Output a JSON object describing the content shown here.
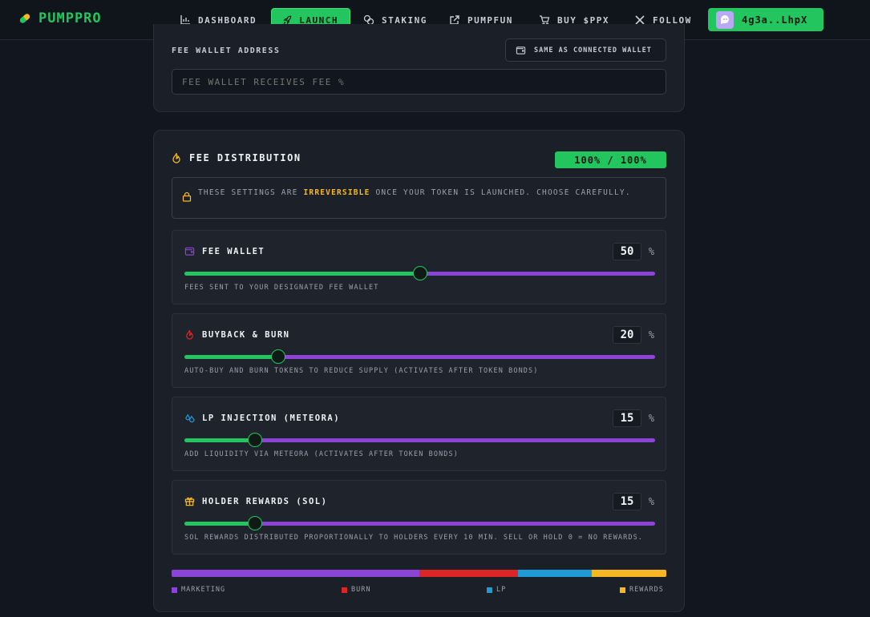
{
  "brand": {
    "name": "PUMPPRO"
  },
  "nav": {
    "items": [
      {
        "label": "DASHBOARD",
        "icon": "bar-chart-icon",
        "active": false
      },
      {
        "label": "LAUNCH",
        "icon": "rocket-icon",
        "active": true
      },
      {
        "label": "STAKING",
        "icon": "coins-icon",
        "active": false
      },
      {
        "label": "PUMPFUN",
        "icon": "external-link-icon",
        "active": false
      },
      {
        "label": "BUY $PPX",
        "icon": "cart-icon",
        "active": false
      },
      {
        "label": "FOLLOW",
        "icon": "x-logo-icon",
        "active": false
      }
    ],
    "wallet": "4g3a..LhpX"
  },
  "fee_wallet": {
    "label": "FEE WALLET ADDRESS",
    "same_button": "SAME AS CONNECTED WALLET",
    "input_placeholder": "FEE WALLET RECEIVES FEE %",
    "input_value": ""
  },
  "distribution": {
    "title": "FEE DISTRIBUTION",
    "total": "100% / 100%",
    "warning": {
      "before": "THESE SETTINGS ARE ",
      "highlight": "IRREVERSIBLE",
      "after": " ONCE YOUR TOKEN IS LAUNCHED. CHOOSE CAREFULLY."
    },
    "allocations": [
      {
        "name": "FEE WALLET",
        "value": 50,
        "value_text": "50",
        "unit": "%",
        "desc": "FEES SENT TO YOUR DESIGNATED FEE WALLET",
        "icon": "wallet-icon",
        "color": "#8b44d6"
      },
      {
        "name": "BUYBACK & BURN",
        "value": 20,
        "value_text": "20",
        "unit": "%",
        "desc": "AUTO-BUY AND BURN TOKENS TO REDUCE SUPPLY (ACTIVATES AFTER TOKEN BONDS)",
        "icon": "flame-icon",
        "color": "#dc2626"
      },
      {
        "name": "LP INJECTION (METEORA)",
        "value": 15,
        "value_text": "15",
        "unit": "%",
        "desc": "ADD LIQUIDITY VIA METEORA (ACTIVATES AFTER TOKEN BONDS)",
        "icon": "droplets-icon",
        "color": "#1e9ad6"
      },
      {
        "name": "HOLDER REWARDS (SOL)",
        "value": 15,
        "value_text": "15",
        "unit": "%",
        "desc": "SOL REWARDS DISTRIBUTED PROPORTIONALLY TO HOLDERS EVERY 10 MIN. SELL OR HOLD 0 = NO REWARDS.",
        "icon": "gift-icon",
        "color": "#f5b824"
      }
    ],
    "legend": [
      {
        "label": "MARKETING",
        "color": "#8b44d6"
      },
      {
        "label": "BURN",
        "color": "#dc2626"
      },
      {
        "label": "LP",
        "color": "#1e9ad6"
      },
      {
        "label": "REWARDS",
        "color": "#f5b824"
      }
    ]
  },
  "colors": {
    "accent": "#22c55e",
    "track": "#8b44d6",
    "highlight": "#f5b824"
  }
}
